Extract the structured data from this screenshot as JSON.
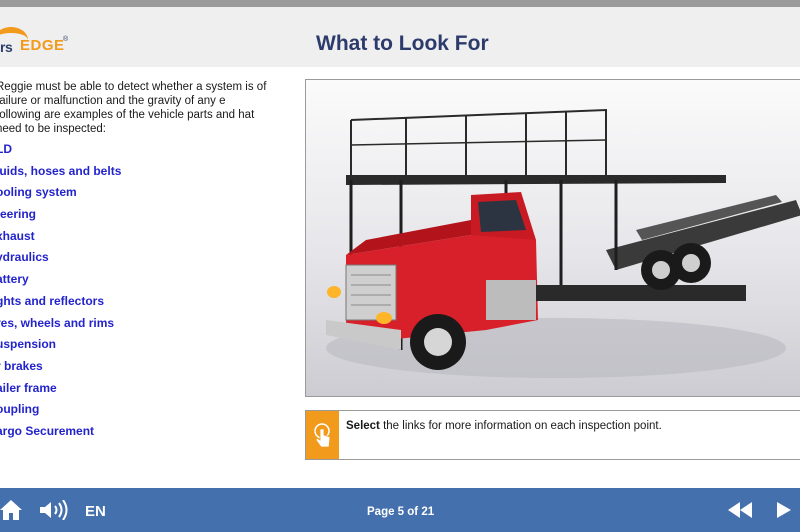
{
  "header": {
    "logo_rs": "rs",
    "logo_edge": "EDGE",
    "logo_reg": "®",
    "title": "What to Look For"
  },
  "content": {
    "intro": "Reggie must be able to detect whether a system is of failure or malfunction and the gravity of any e following are examples of the vehicle parts and hat need to be inspected:",
    "links": [
      "LD",
      "luids, hoses and belts",
      "ooling system",
      "teering",
      "xhaust",
      "ydraulics",
      "attery",
      "ghts and reflectors",
      "res, wheels and rims",
      "uspension",
      "r brakes",
      "ailer frame",
      "oupling",
      "argo Securement"
    ]
  },
  "instruction": {
    "bold": "Select",
    "rest": " the links for more information on each inspection point."
  },
  "footer": {
    "language": "EN",
    "page": "Page 5 of 21"
  },
  "colors": {
    "accent": "#f29a1c",
    "footer": "#4470ad",
    "title": "#2c3b6b",
    "link": "#2323cc"
  },
  "icons": [
    "home-icon",
    "sound-icon",
    "hand-pointer-icon",
    "rewind-icon",
    "play-icon"
  ]
}
